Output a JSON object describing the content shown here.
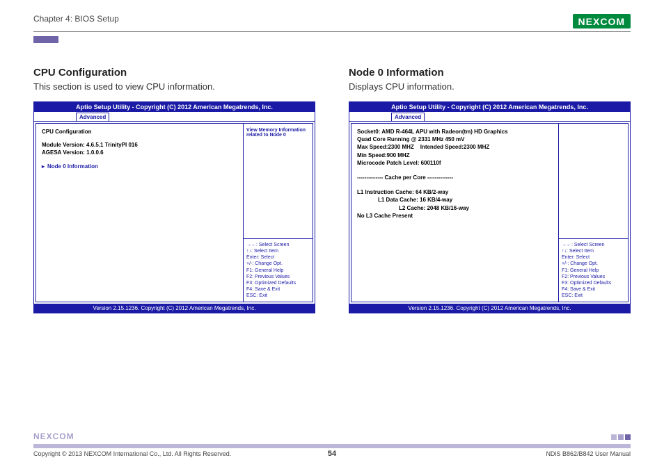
{
  "header": {
    "chapter": "Chapter 4: BIOS Setup",
    "logo_text": "NE COM",
    "logo_x": "X"
  },
  "left": {
    "title": "CPU Configuration",
    "desc": "This section is used to view CPU information.",
    "bios_title": "Aptio Setup Utility - Copyright (C) 2012 American Megatrends, Inc.",
    "tab": "Advanced",
    "lines": {
      "l1": "CPU Configuration",
      "l2": "Module Version: 4.6.5.1 TrinityPI 016",
      "l3": "AGESA Version: 1.0.0.6",
      "sel": "Node 0 Information"
    },
    "side_top": "View Memory Information related to Node 0",
    "bios_footer": "Version 2.15.1236. Copyright (C) 2012 American Megatrends, Inc."
  },
  "right": {
    "title": "Node 0 Information",
    "desc": "Displays CPU information.",
    "bios_title": "Aptio Setup Utility - Copyright (C) 2012 American Megatrends, Inc.",
    "tab": "Advanced",
    "lines": {
      "r1": "Socket0: AMD R-464L APU with Radeon(tm) HD Graphics",
      "r2": "Quad Core Running @ 2331 MHz 450 mV",
      "r3a": "Max Speed:2300 MHZ",
      "r3b": "Intended Speed:2300 MHZ",
      "r4": "Min Speed:900 MHZ",
      "r5": "Microcode Patch Level: 600110f",
      "r6": "-------------- Cache per Core --------------",
      "r7": "L1 Instruction Cache: 64 KB/2-way",
      "r8": "L1 Data Cache: 16 KB/4-way",
      "r9": "L2 Cache: 2048 KB/16-way",
      "r10": "No L3 Cache Present"
    },
    "bios_footer": "Version 2.15.1236. Copyright (C) 2012 American Megatrends, Inc."
  },
  "help": {
    "h1": "→←: Select Screen",
    "h2": "↑↓: Select Item",
    "h3": "Enter: Select",
    "h4": "+/-: Change Opt.",
    "h5": "F1: General Help",
    "h6": "F2: Previous Values",
    "h7": "F3: Optimized Defaults",
    "h8": "F4: Save & Exit",
    "h9": "ESC: Exit"
  },
  "footer": {
    "logo": "NEXCOM",
    "copyright": "Copyright © 2013 NEXCOM International Co., Ltd. All Rights Reserved.",
    "page": "54",
    "manual": "NDiS B862/B842 User Manual"
  }
}
